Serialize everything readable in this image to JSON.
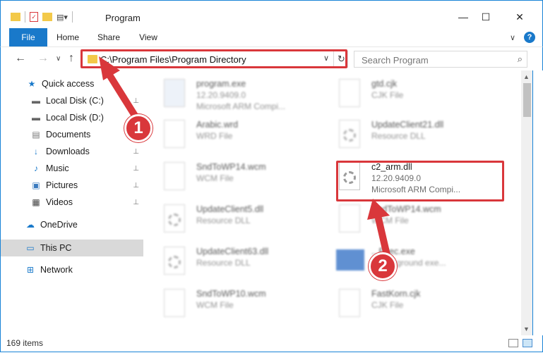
{
  "window": {
    "title": "Program",
    "minimize": "—",
    "maximize": "☐",
    "close": "✕"
  },
  "ribbon": {
    "tabs": [
      "File",
      "Home",
      "Share",
      "View"
    ],
    "expand": "∨",
    "help": "?"
  },
  "nav": {
    "back": "←",
    "forward": "→",
    "recent": "∨",
    "up": "↑",
    "address": "C:\\Program Files\\Program Directory",
    "address_chevron": "∨",
    "refresh": "↻",
    "search_placeholder": "Search Program",
    "search_icon": "⌕"
  },
  "sidebar": {
    "items": [
      {
        "label": "Quick access",
        "icon": "★",
        "pinned": false
      },
      {
        "label": "Local Disk (C:)",
        "icon": "▬",
        "pinned": true
      },
      {
        "label": "Local Disk (D:)",
        "icon": "▬",
        "pinned": false
      },
      {
        "label": "Documents",
        "icon": "▤",
        "pinned": true
      },
      {
        "label": "Downloads",
        "icon": "↓",
        "pinned": true
      },
      {
        "label": "Music",
        "icon": "♪",
        "pinned": true
      },
      {
        "label": "Pictures",
        "icon": "▣",
        "pinned": true
      },
      {
        "label": "Videos",
        "icon": "▦",
        "pinned": true
      },
      {
        "label": "OneDrive",
        "icon": "☁",
        "pinned": false
      },
      {
        "label": "This PC",
        "icon": "▭",
        "pinned": false,
        "selected": true
      },
      {
        "label": "Network",
        "icon": "⊞",
        "pinned": false
      }
    ],
    "pin_glyph": "📌"
  },
  "files": {
    "left": [
      {
        "name": "program.exe",
        "line2": "12.20.9409.0",
        "line3": "Microsoft ARM Compi..."
      },
      {
        "name": "Arabic.wrd",
        "line2": "WRD File",
        "line3": ""
      },
      {
        "name": "SndToWP14.wcm",
        "line2": "WCM File",
        "line3": ""
      },
      {
        "name": "UpdateClient5.dll",
        "line2": "Resource DLL",
        "line3": ""
      },
      {
        "name": "UpdateClient63.dll",
        "line2": "Resource DLL",
        "line3": ""
      },
      {
        "name": "SndToWP10.wcm",
        "line2": "WCM File",
        "line3": ""
      }
    ],
    "right": [
      {
        "name": "gtd.cjk",
        "line2": "CJK File",
        "line3": ""
      },
      {
        "name": "UpdateClient21.dll",
        "line2": "Resource DLL",
        "line3": ""
      },
      {
        "name": "c2_arm.dll",
        "line2": "12.20.9409.0",
        "line3": "Microsoft ARM Compi..."
      },
      {
        "name": "SndToWP14.wcm",
        "line2": "WCM File",
        "line3": ""
      },
      {
        "name": "...Exec.exe",
        "line2": "...background exe...",
        "line3": ""
      },
      {
        "name": "FastKorn.cjk",
        "line2": "CJK File",
        "line3": ""
      }
    ]
  },
  "status": {
    "items": "169 items"
  },
  "annotations": {
    "step1": "1",
    "step2": "2"
  },
  "colors": {
    "accent": "#1979ca",
    "highlight": "#d9373b",
    "folder": "#f3c949"
  }
}
